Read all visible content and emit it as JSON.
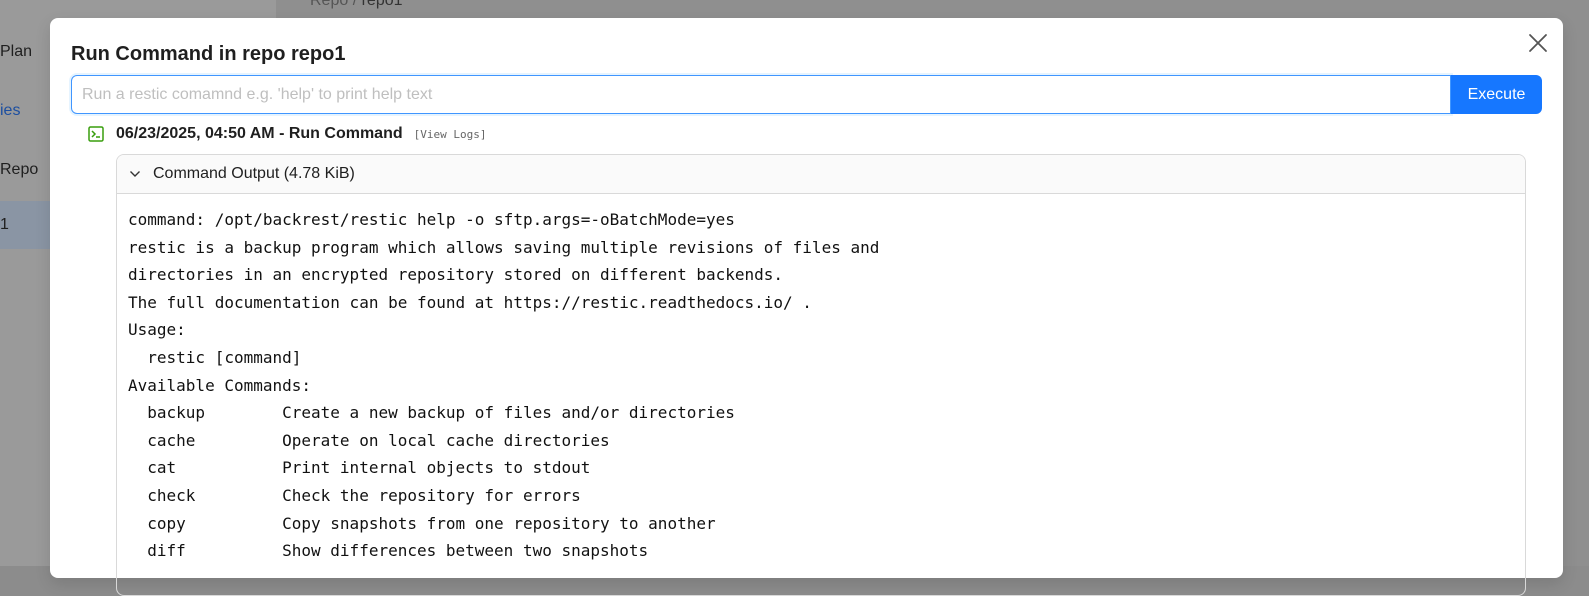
{
  "background": {
    "breadcrumb_root": "Repo",
    "breadcrumb_sep": " / ",
    "breadcrumb_current": "repo1",
    "sidebar_items": [
      "Plan",
      "ies",
      "Repo",
      "1"
    ]
  },
  "modal": {
    "title": "Run Command in repo repo1",
    "input_placeholder": "Run a restic comamnd e.g. 'help' to print help text",
    "input_value": "",
    "execute_label": "Execute"
  },
  "operation": {
    "title": "06/23/2025, 04:50 AM - Run Command",
    "view_logs_label": "[View Logs]",
    "status_color": "#389e0d",
    "collapse_label": "Command Output (4.78 KiB)",
    "output_lines": [
      "command: /opt/backrest/restic help -o sftp.args=-oBatchMode=yes",
      "restic is a backup program which allows saving multiple revisions of files and",
      "directories in an encrypted repository stored on different backends.",
      "The full documentation can be found at https://restic.readthedocs.io/ .",
      "Usage:",
      "  restic [command]",
      "Available Commands:",
      "  backup        Create a new backup of files and/or directories",
      "  cache         Operate on local cache directories",
      "  cat           Print internal objects to stdout",
      "  check         Check the repository for errors",
      "  copy          Copy snapshots from one repository to another",
      "  diff          Show differences between two snapshots"
    ]
  }
}
